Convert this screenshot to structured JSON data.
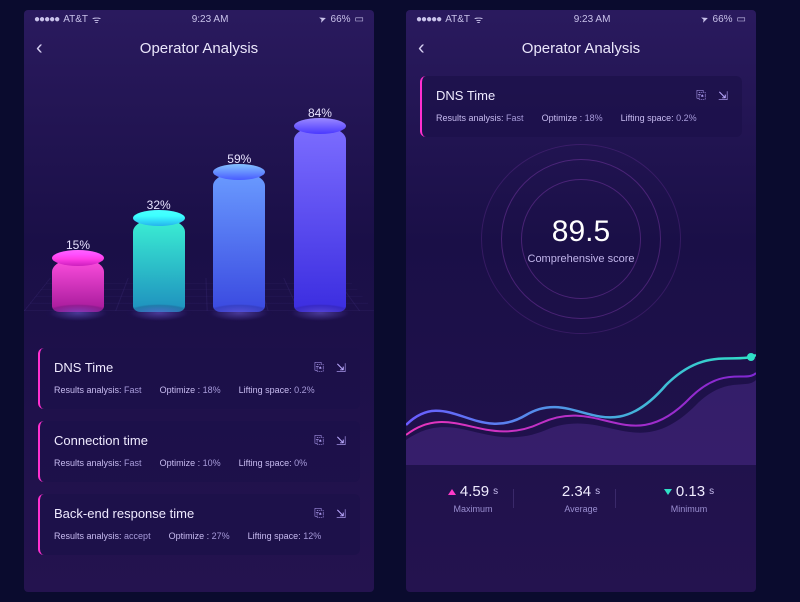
{
  "status": {
    "carrier": "AT&T",
    "time": "9:23 AM",
    "battery": "66%"
  },
  "nav": {
    "title": "Operator Analysis"
  },
  "chart_data": {
    "type": "bar",
    "categories": [
      "",
      "",
      "",
      ""
    ],
    "values": [
      15,
      32,
      59,
      84
    ],
    "value_labels": [
      "15%",
      "32%",
      "59%",
      "84%"
    ],
    "ylim": [
      0,
      100
    ]
  },
  "cards": [
    {
      "title": "DNS Time",
      "analysis_label": "Results analysis:",
      "analysis_value": "Fast",
      "optimize_label": "Optimize :",
      "optimize_value": "18%",
      "lifting_label": "Lifting space:",
      "lifting_value": "0.2%"
    },
    {
      "title": "Connection time",
      "analysis_label": "Results analysis:",
      "analysis_value": "Fast",
      "optimize_label": "Optimize :",
      "optimize_value": "10%",
      "lifting_label": "Lifting space:",
      "lifting_value": "0%"
    },
    {
      "title": "Back-end response time",
      "analysis_label": "Results analysis:",
      "analysis_value": "accept",
      "optimize_label": "Optimize :",
      "optimize_value": "27%",
      "lifting_label": "Lifting space:",
      "lifting_value": "12%"
    }
  ],
  "detail": {
    "card": {
      "title": "DNS Time",
      "analysis_label": "Results analysis:",
      "analysis_value": "Fast",
      "optimize_label": "Optimize :",
      "optimize_value": "18%",
      "lifting_label": "Lifting space:",
      "lifting_value": "0.2%"
    },
    "score": "89.5",
    "score_label": "Comprehensive score",
    "stats": {
      "max": {
        "value": "4.59",
        "unit": "s",
        "label": "Maximum"
      },
      "avg": {
        "value": "2.34",
        "unit": "s",
        "label": "Average"
      },
      "min": {
        "value": "0.13",
        "unit": "s",
        "label": "Minimum"
      }
    }
  },
  "icons": {
    "copy": "⎘",
    "export": "⇲",
    "wifi": "ᯤ",
    "nav": "➤",
    "batt": "▭"
  }
}
